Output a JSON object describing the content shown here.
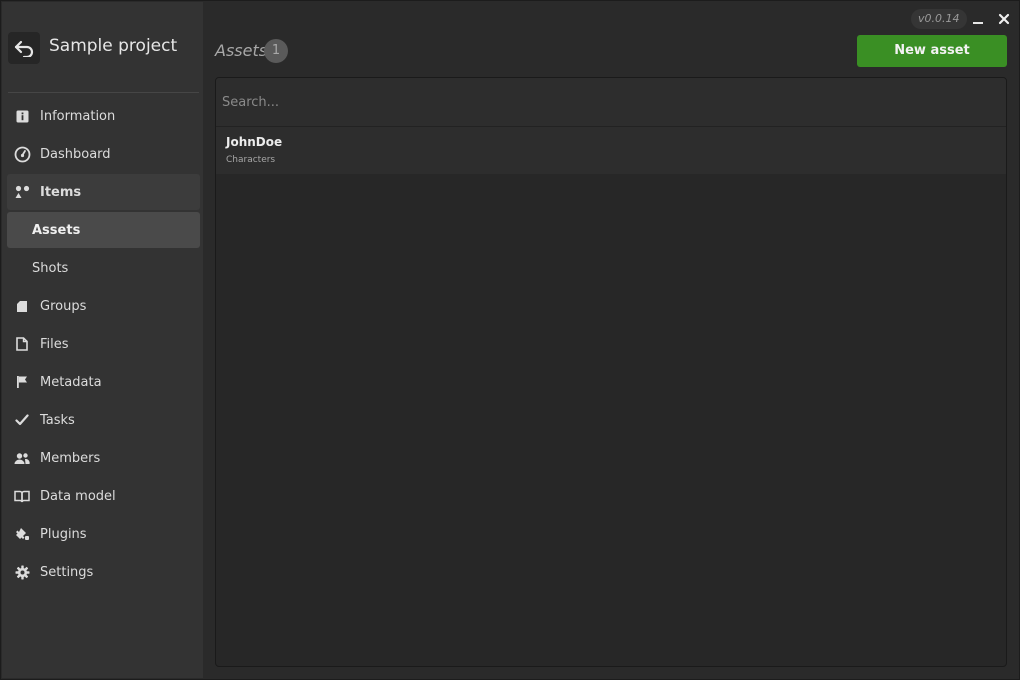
{
  "app": {
    "project_title": "Sample project",
    "version": "v0.0.14"
  },
  "sidebar": {
    "items": [
      {
        "label": "Information",
        "icon": "info-icon"
      },
      {
        "label": "Dashboard",
        "icon": "gauge-icon"
      },
      {
        "label": "Items",
        "icon": "items-icon"
      },
      {
        "label": "Assets"
      },
      {
        "label": "Shots"
      },
      {
        "label": "Groups",
        "icon": "folder-icon"
      },
      {
        "label": "Files",
        "icon": "file-icon"
      },
      {
        "label": "Metadata",
        "icon": "flag-icon"
      },
      {
        "label": "Tasks",
        "icon": "check-icon"
      },
      {
        "label": "Members",
        "icon": "users-icon"
      },
      {
        "label": "Data model",
        "icon": "book-icon"
      },
      {
        "label": "Plugins",
        "icon": "plugin-icon"
      },
      {
        "label": "Settings",
        "icon": "gear-icon"
      }
    ]
  },
  "header": {
    "title": "Assets",
    "count": "1",
    "new_button": "New asset"
  },
  "search": {
    "placeholder": "Search..."
  },
  "assets": [
    {
      "name": "JohnDoe",
      "group": "Characters"
    }
  ],
  "colors": {
    "accent": "#3a8f24",
    "selected": "#4a4a4a",
    "sidebar_bg": "#333333"
  }
}
